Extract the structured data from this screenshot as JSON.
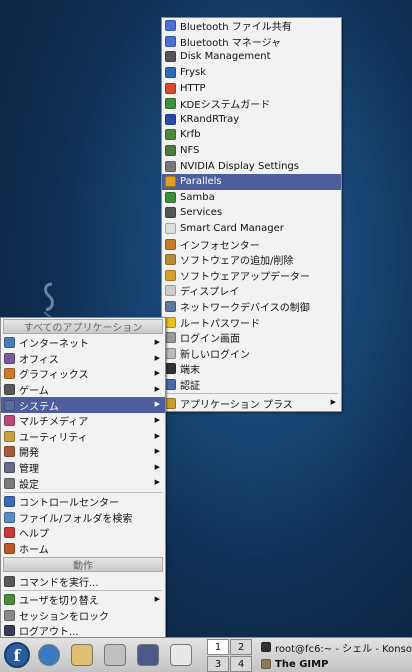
{
  "desktop": {
    "logo_icon": "fedora-swirl-watermark"
  },
  "submenu": {
    "items": [
      {
        "label": "Bluetooth ファイル共有",
        "icon": "bluetooth-icon",
        "color": "#4d6fd1"
      },
      {
        "label": "Bluetooth マネージャ",
        "icon": "bluetooth-icon",
        "color": "#4d6fd1"
      },
      {
        "label": "Disk Management",
        "icon": "disk-icon",
        "color": "#555555"
      },
      {
        "label": "Frysk",
        "icon": "frysk-icon",
        "color": "#2a6db8"
      },
      {
        "label": "HTTP",
        "icon": "http-icon",
        "color": "#d94a2a"
      },
      {
        "label": "KDEシステムガード",
        "icon": "ksysguard-icon",
        "color": "#3f8f3a"
      },
      {
        "label": "KRandRTray",
        "icon": "krandr-icon",
        "color": "#2c4aa8"
      },
      {
        "label": "Krfb",
        "icon": "krfb-icon",
        "color": "#4a8a3a"
      },
      {
        "label": "NFS",
        "icon": "nfs-icon",
        "color": "#4a7a3a"
      },
      {
        "label": "NVIDIA Display Settings",
        "icon": "nvidia-icon",
        "color": "#777777"
      },
      {
        "label": "Parallels",
        "icon": "parallels-icon",
        "color": "#e0a020"
      },
      {
        "label": "Samba",
        "icon": "samba-icon",
        "color": "#3f8f3a"
      },
      {
        "label": "Services",
        "icon": "services-icon",
        "color": "#555555"
      },
      {
        "label": "Smart Card Manager",
        "icon": "smartcard-icon",
        "color": "#dddddd"
      },
      {
        "label": "インフォセンター",
        "icon": "info-center-icon",
        "color": "#c77a2a"
      },
      {
        "label": "ソフトウェアの追加/削除",
        "icon": "software-add-remove-icon",
        "color": "#b88a3a"
      },
      {
        "label": "ソフトウェアアップデーター",
        "icon": "software-updater-icon",
        "color": "#d9a030"
      },
      {
        "label": "ディスプレイ",
        "icon": "display-icon",
        "color": "#cccccc"
      },
      {
        "label": "ネットワークデバイスの制御",
        "icon": "network-device-icon",
        "color": "#5a7a9a"
      },
      {
        "label": "ルートパスワード",
        "icon": "root-password-icon",
        "color": "#e8c020"
      },
      {
        "label": "ログイン画面",
        "icon": "login-screen-icon",
        "color": "#999999"
      },
      {
        "label": "新しいログイン",
        "icon": "new-login-icon",
        "color": "#bbbbbb"
      },
      {
        "label": "端末",
        "icon": "terminal-icon",
        "color": "#333333"
      },
      {
        "label": "認証",
        "icon": "authentication-icon",
        "color": "#4a6aa8"
      },
      {
        "label": "アプリケーション プラス",
        "icon": "application-plus-icon",
        "color": "#c89a30"
      }
    ],
    "highlighted": "Parallels"
  },
  "mainmenu": {
    "header_all_apps": "すべてのアプリケーション",
    "categories": [
      {
        "label": "インターネット",
        "icon": "internet-icon",
        "color": "#4a7ab8"
      },
      {
        "label": "オフィス",
        "icon": "office-icon",
        "color": "#7a5a9a"
      },
      {
        "label": "グラフィックス",
        "icon": "graphics-icon",
        "color": "#d07a2a"
      },
      {
        "label": "ゲーム",
        "icon": "game-icon",
        "color": "#5a5a5a"
      },
      {
        "label": "システム",
        "icon": "system-icon",
        "color": "#5a6aa0"
      },
      {
        "label": "マルチメディア",
        "icon": "multimedia-icon",
        "color": "#b84a7a"
      },
      {
        "label": "ユーティリティ",
        "icon": "utility-icon",
        "color": "#c8a040"
      },
      {
        "label": "開発",
        "icon": "development-icon",
        "color": "#a85a3a"
      },
      {
        "label": "管理",
        "icon": "admin-icon",
        "color": "#6a6a8a"
      },
      {
        "label": "設定",
        "icon": "settings-icon",
        "color": "#7a7a7a"
      }
    ],
    "highlighted": "システム",
    "extras": [
      {
        "label": "コントロールセンター",
        "icon": "control-center-icon",
        "color": "#3a6ab8"
      },
      {
        "label": "ファイル/フォルダを検索",
        "icon": "search-icon",
        "color": "#5a8ac8"
      },
      {
        "label": "ヘルプ",
        "icon": "help-icon",
        "color": "#c83a3a"
      },
      {
        "label": "ホーム",
        "icon": "home-icon",
        "color": "#b85a2a"
      }
    ],
    "header_actions": "動作",
    "actions": [
      {
        "label": "コマンドを実行...",
        "icon": "run-command-icon",
        "color": "#5a5a5a",
        "sub": false
      },
      {
        "label": "ユーザを切り替え",
        "icon": "switch-user-icon",
        "color": "#4a8a3a",
        "sub": true
      },
      {
        "label": "セッションをロック",
        "icon": "lock-icon",
        "color": "#888888",
        "sub": false
      },
      {
        "label": "ログアウト...",
        "icon": "logout-icon",
        "color": "#3a3a5a",
        "sub": false
      }
    ]
  },
  "taskbar": {
    "launchers": [
      {
        "name": "fedora-menu-icon",
        "color": "#2b5c9c"
      },
      {
        "name": "web-browser-icon",
        "color": "#3a7ac0"
      },
      {
        "name": "kmail-icon",
        "color": "#e0c070"
      },
      {
        "name": "konqueror-icon",
        "color": "#c0c0c0"
      },
      {
        "name": "terminal-icon",
        "color": "#4a5a8a"
      },
      {
        "name": "office-icon",
        "color": "#e8e8e8"
      }
    ],
    "fedora_glyph": "f",
    "pager": [
      "1",
      "2",
      "3",
      "4"
    ],
    "tasks": [
      {
        "label": "root@fc6:~ - シェル - Konso",
        "icon": "konsole-icon",
        "color": "#333333"
      },
      {
        "label": "The GIMP",
        "icon": "gimp-icon",
        "color": "#8a7a5a"
      }
    ]
  }
}
